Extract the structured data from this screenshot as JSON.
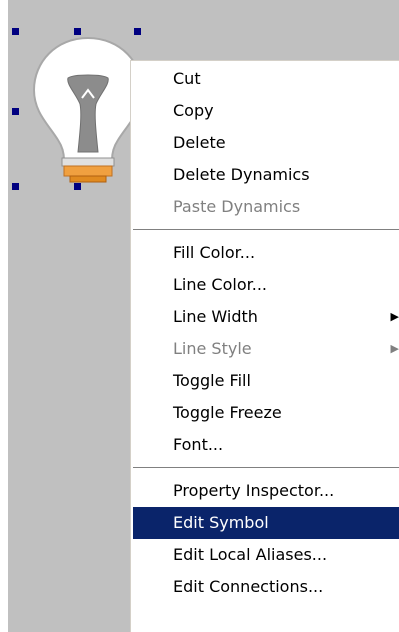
{
  "canvas": {
    "background": "#c0c0c0"
  },
  "symbol": {
    "icon": "lightbulb-icon"
  },
  "context_menu": {
    "groups": [
      [
        {
          "label": "Cut",
          "enabled": true
        },
        {
          "label": "Copy",
          "enabled": true
        },
        {
          "label": "Delete",
          "enabled": true
        },
        {
          "label": "Delete Dynamics",
          "enabled": true
        },
        {
          "label": "Paste Dynamics",
          "enabled": false
        }
      ],
      [
        {
          "label": "Fill Color...",
          "enabled": true
        },
        {
          "label": "Line Color...",
          "enabled": true
        },
        {
          "label": "Line Width",
          "enabled": true,
          "submenu": true
        },
        {
          "label": "Line Style",
          "enabled": false,
          "submenu": true
        },
        {
          "label": "Toggle Fill",
          "enabled": true
        },
        {
          "label": "Toggle Freeze",
          "enabled": true
        },
        {
          "label": "Font...",
          "enabled": true
        }
      ],
      [
        {
          "label": "Property Inspector...",
          "enabled": true
        },
        {
          "label": "Edit Symbol",
          "enabled": true,
          "highlighted": true
        },
        {
          "label": "Edit Local Aliases...",
          "enabled": true
        },
        {
          "label": "Edit Connections...",
          "enabled": true
        }
      ]
    ],
    "highlight_color": "#0a246a"
  }
}
